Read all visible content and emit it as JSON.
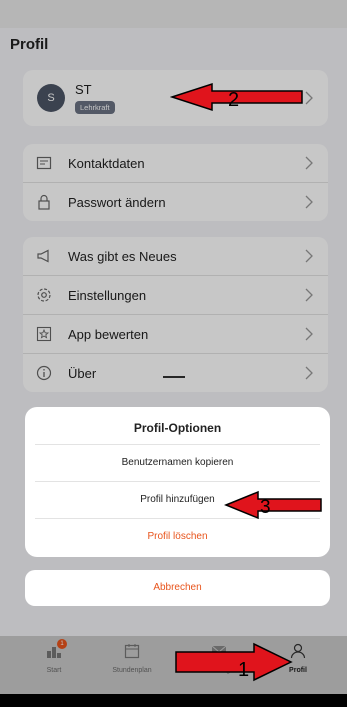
{
  "page_title": "Profil",
  "profile": {
    "initials": "S",
    "name": "ST",
    "role": "Lehrkraft"
  },
  "menu_group_1": [
    {
      "label": "Kontaktdaten",
      "icon": "contact-card-icon"
    },
    {
      "label": "Passwort ändern",
      "icon": "lock-icon"
    }
  ],
  "menu_group_2": [
    {
      "label": "Was gibt es Neues",
      "icon": "megaphone-icon"
    },
    {
      "label": "Einstellungen",
      "icon": "gear-icon"
    },
    {
      "label": "App bewerten",
      "icon": "star-icon"
    },
    {
      "label": "Über",
      "icon": "info-icon"
    }
  ],
  "sheet": {
    "title": "Profil-Optionen",
    "options": [
      "Benutzernamen kopieren",
      "Profil hinzufügen",
      "Profil löschen"
    ],
    "cancel": "Abbrechen"
  },
  "tabbar": {
    "tabs": [
      {
        "label": "Start",
        "badge": "1"
      },
      {
        "label": "Stundenplan"
      },
      {
        "label": "Mitteilungen"
      },
      {
        "label": "Profil"
      }
    ]
  },
  "annotations": [
    "1",
    "2",
    "3"
  ],
  "colors": {
    "accent": "#e8541c",
    "arrow": "#e0141c",
    "badge_bg": "#6b7283"
  }
}
